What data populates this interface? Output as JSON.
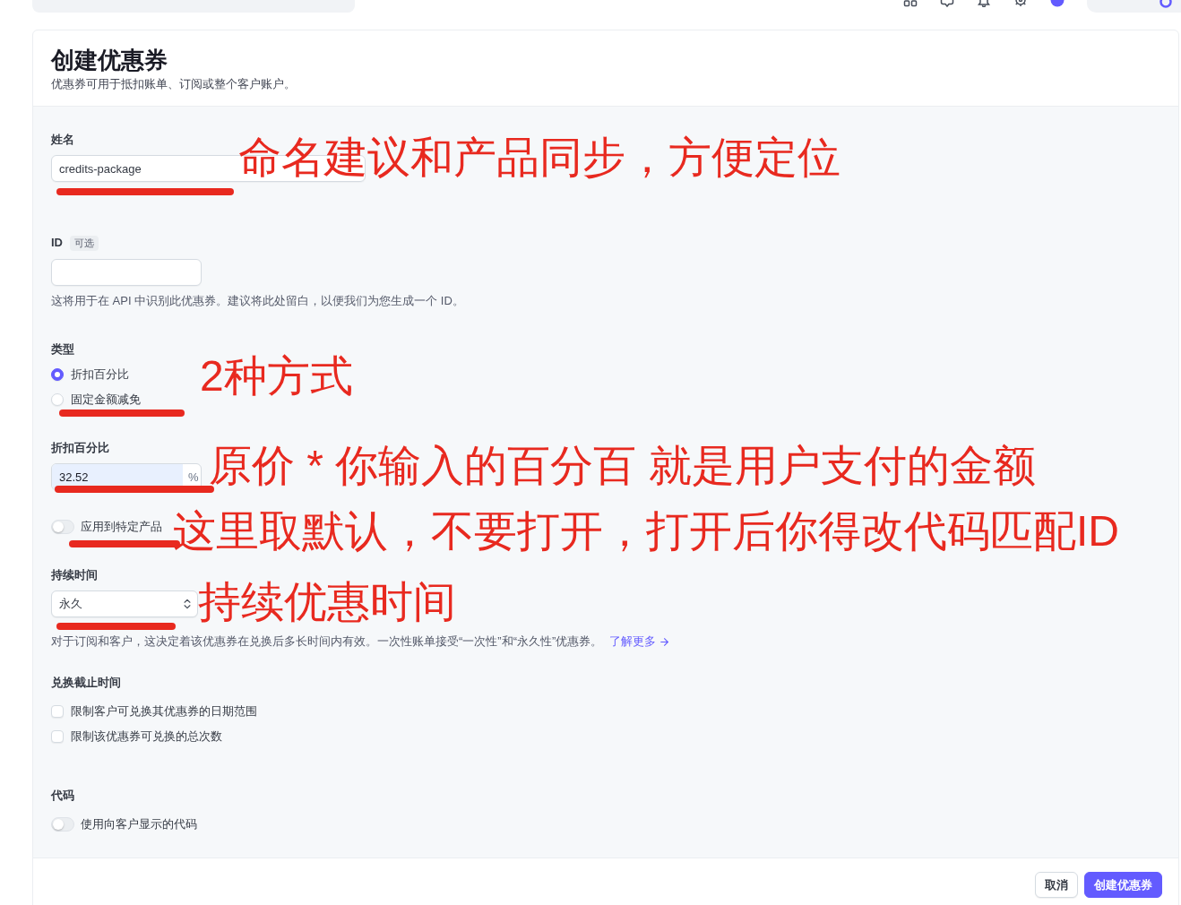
{
  "page": {
    "title": "创建优惠券",
    "subtitle": "优惠券可用于抵扣账单、订阅或整个客户账户。"
  },
  "form": {
    "name": {
      "label": "姓名",
      "value": "credits-package",
      "annotation": "命名建议和产品同步，方便定位"
    },
    "id": {
      "label": "ID",
      "badge": "可选",
      "help": "这将用于在 API 中识别此优惠券。建议将此处留白，以便我们为您生成一个 ID。"
    },
    "type": {
      "label": "类型",
      "options": [
        {
          "label": "折扣百分比",
          "selected": true
        },
        {
          "label": "固定金额减免",
          "selected": false
        }
      ],
      "annotation": "2种方式"
    },
    "percent_off": {
      "label": "折扣百分比",
      "value": "32.52",
      "suffix": "%",
      "annotation": "原价 * 你输入的百分百 就是用户支付的金额"
    },
    "specific_products": {
      "label": "应用到特定产品",
      "on": false,
      "annotation": "这里取默认，不要打开，打开后你得改代码匹配ID"
    },
    "duration": {
      "label": "持续时间",
      "value": "永久",
      "help": "对于订阅和客户，这决定着该优惠券在兑换后多长时间内有效。一次性账单接受“一次性”和“永久性”优惠券。",
      "link": "了解更多",
      "annotation": "持续优惠时间"
    },
    "redemption_limits": {
      "label": "兑换截止时间",
      "options": [
        {
          "label": "限制客户可兑换其优惠券的日期范围",
          "checked": false
        },
        {
          "label": "限制该优惠券可兑换的总次数",
          "checked": false
        }
      ]
    },
    "code": {
      "label": "代码",
      "toggle": {
        "label": "使用向客户显示的代码",
        "on": false
      }
    }
  },
  "footer": {
    "buttons": [
      {
        "label": "取消",
        "kind": "secondary"
      },
      {
        "label": "创建优惠券",
        "kind": "primary"
      }
    ]
  }
}
